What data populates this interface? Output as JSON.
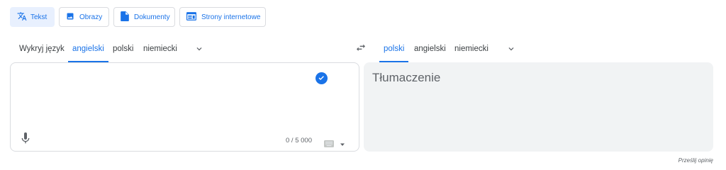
{
  "modes": [
    {
      "label": "Tekst",
      "icon": "translate-icon"
    },
    {
      "label": "Obrazy",
      "icon": "image-icon"
    },
    {
      "label": "Dokumenty",
      "icon": "document-icon"
    },
    {
      "label": "Strony internetowe",
      "icon": "website-icon"
    }
  ],
  "source_langs": [
    "Wykryj język",
    "angielski",
    "polski",
    "niemiecki"
  ],
  "target_langs": [
    "polski",
    "angielski",
    "niemiecki"
  ],
  "target": {
    "placeholder": "Tłumaczenie"
  },
  "source": {
    "char_count": "0 / 5 000"
  },
  "footer": {
    "feedback": "Prześlij opinię"
  },
  "colors": {
    "accent": "#1a73e8",
    "panel_bg": "#f1f3f4",
    "check": "#1a73e8"
  }
}
